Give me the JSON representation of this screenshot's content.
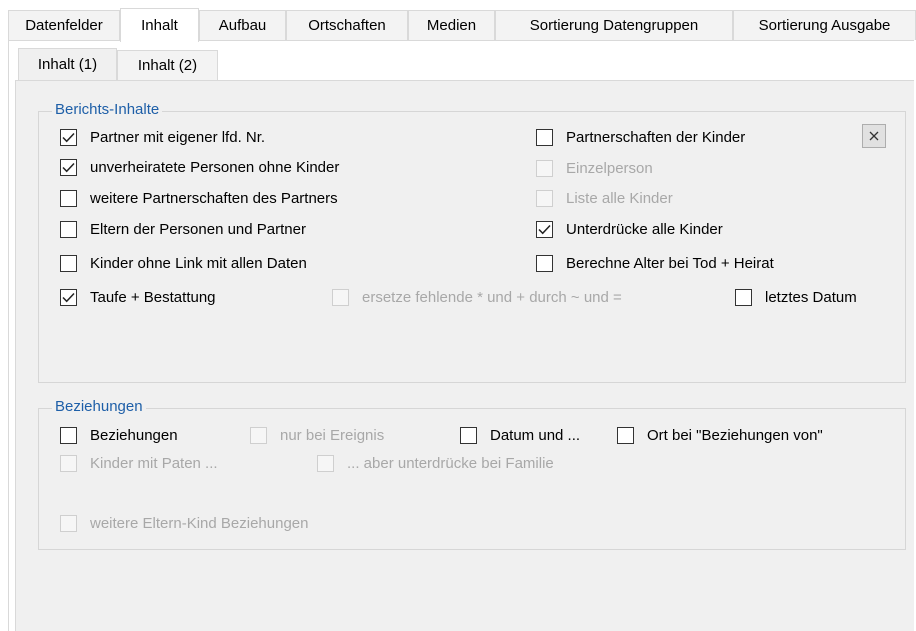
{
  "tabs": [
    "Datenfelder",
    "Inhalt",
    "Aufbau",
    "Ortschaften",
    "Medien",
    "Sortierung Datengruppen",
    "Sortierung Ausgabe"
  ],
  "active_tab": "Inhalt",
  "subtabs": [
    "Inhalt (1)",
    "Inhalt (2)"
  ],
  "active_subtab": "Inhalt (1)",
  "berichts_inhalte": {
    "legend": "Berichts-Inhalte",
    "close_icon": "close-x-icon",
    "checkboxes": [
      {
        "label": "Partner mit eigener lfd. Nr.",
        "checked": true,
        "enabled": true
      },
      {
        "label": "unverheiratete Personen ohne Kinder",
        "checked": true,
        "enabled": true
      },
      {
        "label": "weitere Partnerschaften des Partners",
        "checked": false,
        "enabled": true
      },
      {
        "label": "Eltern der Personen und Partner",
        "checked": false,
        "enabled": true
      },
      {
        "label": "Kinder ohne Link mit allen Daten",
        "checked": false,
        "enabled": true
      },
      {
        "label": "Taufe + Bestattung",
        "checked": true,
        "enabled": true
      },
      {
        "label": "Partnerschaften der Kinder",
        "checked": false,
        "enabled": true
      },
      {
        "label": "Einzelperson",
        "checked": false,
        "enabled": false
      },
      {
        "label": "Liste alle Kinder",
        "checked": false,
        "enabled": false
      },
      {
        "label": "Unterdrücke alle Kinder",
        "checked": true,
        "enabled": true
      },
      {
        "label": "Berechne Alter bei Tod + Heirat",
        "checked": false,
        "enabled": true
      },
      {
        "label": "ersetze fehlende * und + durch ~ und =",
        "checked": false,
        "enabled": false
      },
      {
        "label": "letztes Datum",
        "checked": false,
        "enabled": true
      }
    ]
  },
  "beziehungen": {
    "legend": "Beziehungen",
    "checkboxes": [
      {
        "label": "Beziehungen",
        "checked": false,
        "enabled": true
      },
      {
        "label": "nur bei Ereignis",
        "checked": false,
        "enabled": false
      },
      {
        "label": "Datum und ...",
        "checked": false,
        "enabled": true
      },
      {
        "label": "Ort bei \"Beziehungen von\"",
        "checked": false,
        "enabled": true
      },
      {
        "label": "Kinder mit Paten ...",
        "checked": false,
        "enabled": false
      },
      {
        "label": "... aber unterdrücke bei Familie",
        "checked": false,
        "enabled": false
      },
      {
        "label": "weitere Eltern-Kind Beziehungen",
        "checked": false,
        "enabled": false
      }
    ]
  },
  "colors": {
    "legend": "#1e5fa8",
    "disabled_text": "#a8a8a8",
    "panel_bg": "#f0f0f0"
  }
}
